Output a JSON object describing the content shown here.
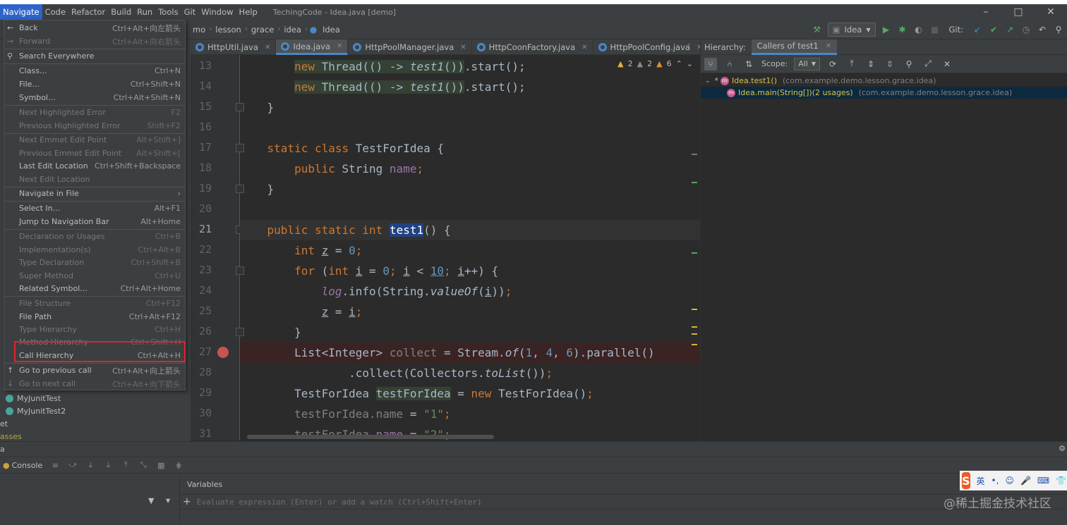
{
  "menubar": {
    "items": [
      "Navigate",
      "Code",
      "Refactor",
      "Build",
      "Run",
      "Tools",
      "Git",
      "Window",
      "Help"
    ],
    "title": "TechingCode - Idea.java [demo]"
  },
  "navbar": {
    "crumbs": [
      "mo",
      "lesson",
      "grace",
      "idea",
      "Idea"
    ],
    "run_config": "Idea",
    "git_label": "Git:"
  },
  "tabs": [
    "HttpUtil.java",
    "Idea.java",
    "HttpPoolManager.java",
    "HttpCoonFactory.java",
    "HttpPoolConfig.java"
  ],
  "editor": {
    "warnings": {
      "a": "2",
      "b": "2",
      "c": "6"
    },
    "line_numbers": [
      "13",
      "14",
      "15",
      "16",
      "17",
      "18",
      "19",
      "20",
      "21",
      "22",
      "23",
      "24",
      "25",
      "26",
      "27",
      "28",
      "29",
      "30",
      "31"
    ]
  },
  "hierarchy": {
    "label": "Hierarchy:",
    "tab": "Callers of test1",
    "scope_label": "Scope:",
    "scope_value": "All",
    "rows": [
      {
        "name": "Idea.test1()",
        "pkg": "(com.example.demo.lesson.grace.idea)"
      },
      {
        "name": "Idea.main(String[])(2 usages)",
        "pkg": "(com.example.demo.lesson.grace.idea)"
      }
    ]
  },
  "menu": {
    "items": [
      {
        "label": "Back",
        "shortcut": "Ctrl+Alt+向左箭头"
      },
      {
        "label": "Forward",
        "shortcut": "Ctrl+Alt+向右箭头"
      },
      {
        "label": "Search Everywhere",
        "shortcut": ""
      },
      {
        "label": "Class...",
        "shortcut": "Ctrl+N"
      },
      {
        "label": "File...",
        "shortcut": "Ctrl+Shift+N"
      },
      {
        "label": "Symbol...",
        "shortcut": "Ctrl+Alt+Shift+N"
      },
      {
        "label": "Next Highlighted Error",
        "shortcut": "F2"
      },
      {
        "label": "Previous Highlighted Error",
        "shortcut": "Shift+F2"
      },
      {
        "label": "Next Emmet Edit Point",
        "shortcut": "Alt+Shift+]"
      },
      {
        "label": "Previous Emmet Edit Point",
        "shortcut": "Alt+Shift+["
      },
      {
        "label": "Last Edit Location",
        "shortcut": "Ctrl+Shift+Backspace"
      },
      {
        "label": "Next Edit Location",
        "shortcut": ""
      },
      {
        "label": "Navigate in File",
        "shortcut": ""
      },
      {
        "label": "Select In...",
        "shortcut": "Alt+F1"
      },
      {
        "label": "Jump to Navigation Bar",
        "shortcut": "Alt+Home"
      },
      {
        "label": "Declaration or Usages",
        "shortcut": "Ctrl+B"
      },
      {
        "label": "Implementation(s)",
        "shortcut": "Ctrl+Alt+B"
      },
      {
        "label": "Type Declaration",
        "shortcut": "Ctrl+Shift+B"
      },
      {
        "label": "Super Method",
        "shortcut": "Ctrl+U"
      },
      {
        "label": "Related Symbol...",
        "shortcut": "Ctrl+Alt+Home"
      },
      {
        "label": "File Structure",
        "shortcut": "Ctrl+F12"
      },
      {
        "label": "File Path",
        "shortcut": "Ctrl+Alt+F12"
      },
      {
        "label": "Type Hierarchy",
        "shortcut": "Ctrl+H"
      },
      {
        "label": "Method Hierarchy",
        "shortcut": "Ctrl+Shift+H"
      },
      {
        "label": "Call Hierarchy",
        "shortcut": "Ctrl+Alt+H"
      },
      {
        "label": "Go to previous call",
        "shortcut": "Ctrl+Alt+向上箭头"
      },
      {
        "label": "Go to next call",
        "shortcut": "Ctrl+Alt+向下箭头"
      }
    ]
  },
  "left_panel": {
    "items": [
      "MyJunitTest",
      "MyJunitTest2"
    ],
    "fragments": [
      "et",
      "asses",
      "a"
    ]
  },
  "bottom": {
    "console_tab": "Console",
    "variables_label": "Variables",
    "eval_placeholder": "Evaluate expression (Enter) or add a watch (Ctrl+Shift+Enter)"
  },
  "ime": {
    "logo": "S",
    "lang": "英"
  },
  "watermark": "@稀土掘金技术社区"
}
